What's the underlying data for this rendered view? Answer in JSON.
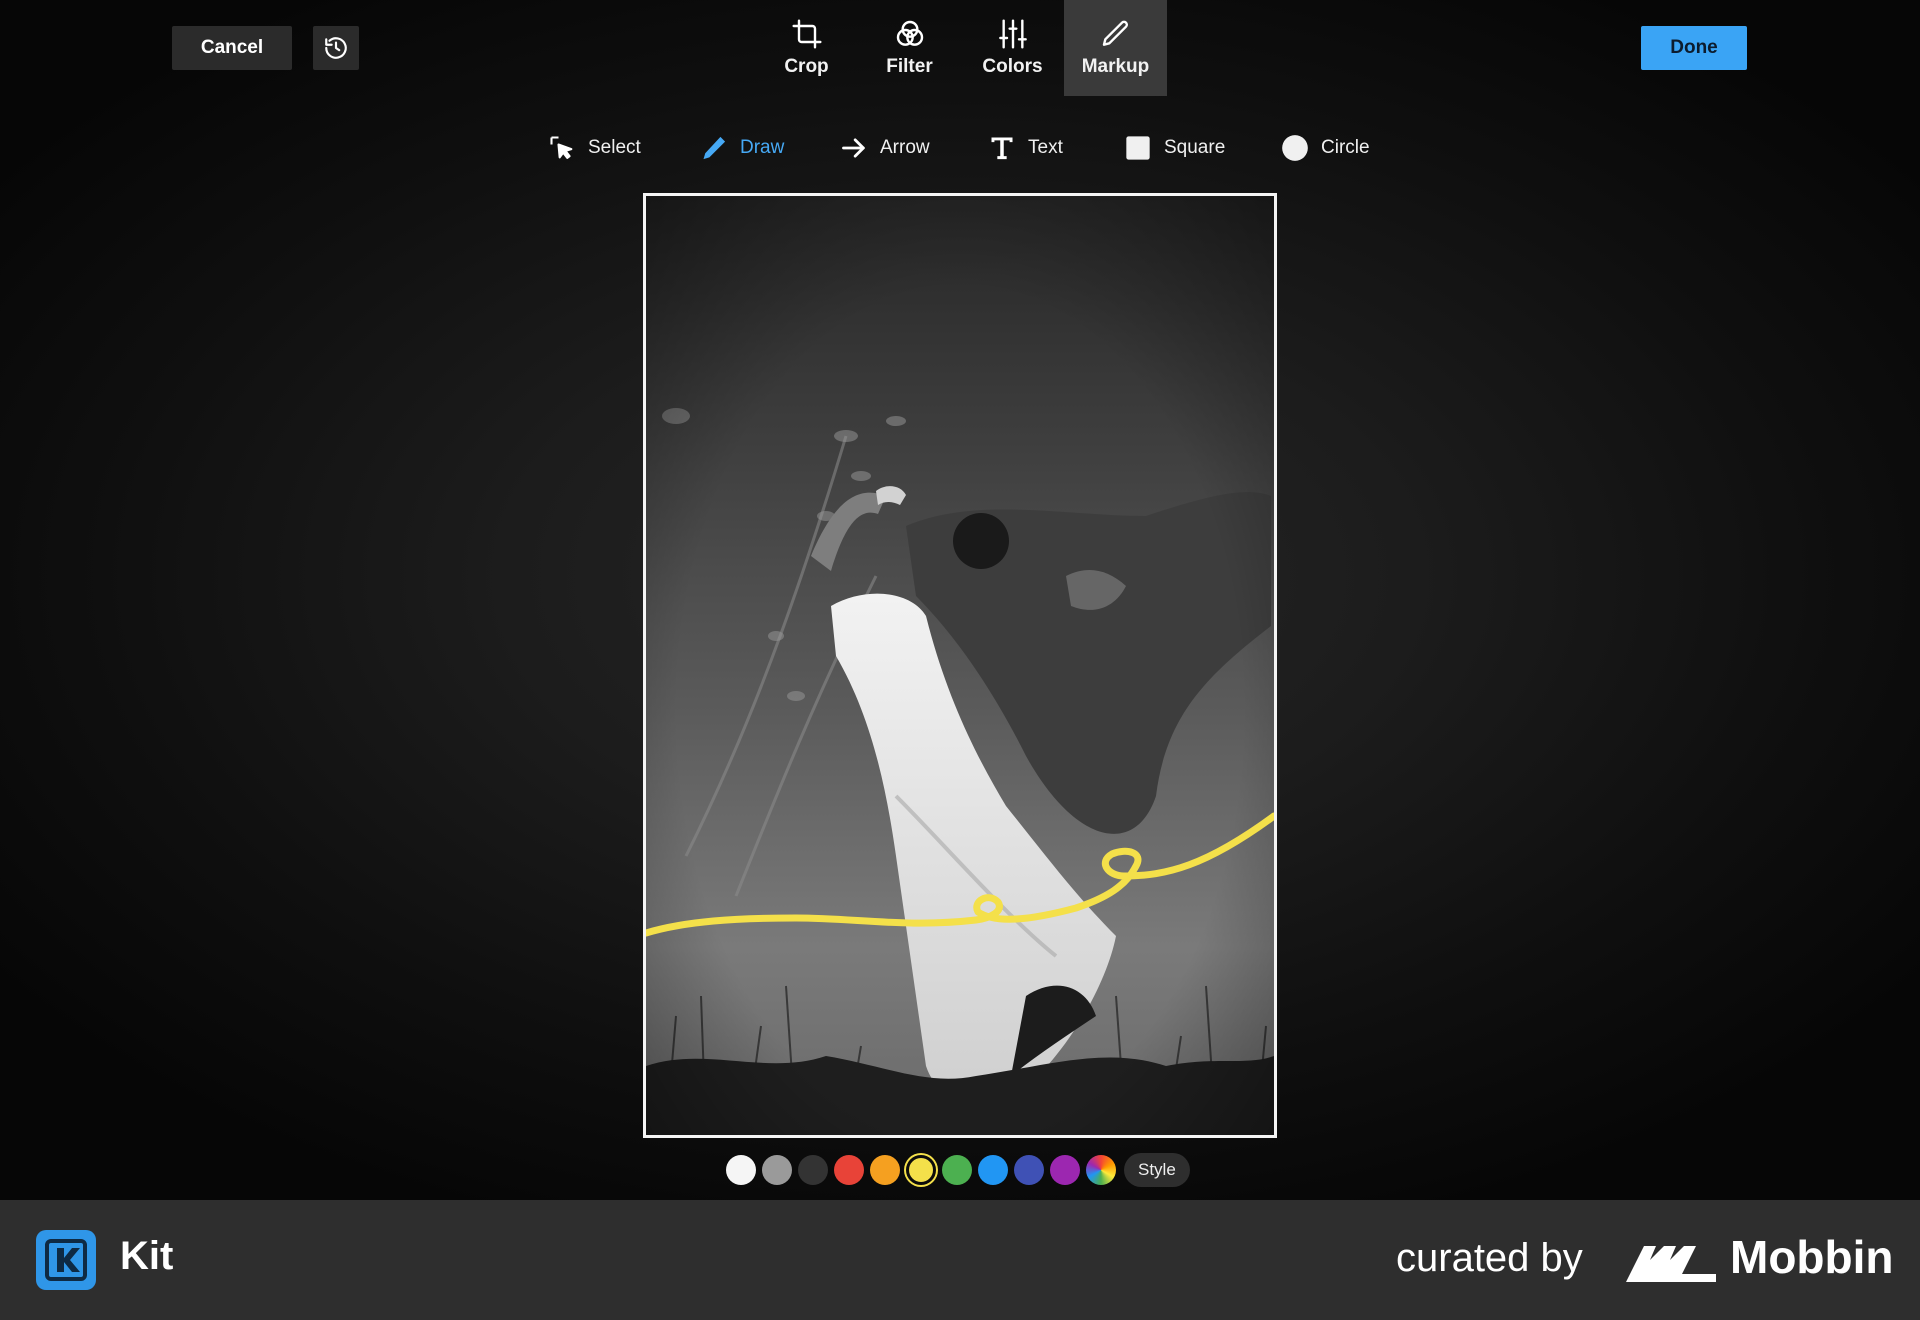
{
  "toolbar": {
    "cancel_label": "Cancel",
    "done_label": "Done",
    "history_icon": "history-icon"
  },
  "tabs": [
    {
      "label": "Crop",
      "icon": "crop-icon"
    },
    {
      "label": "Filter",
      "icon": "filter-icon"
    },
    {
      "label": "Colors",
      "icon": "sliders-icon"
    },
    {
      "label": "Markup",
      "icon": "pencil-icon",
      "active": true
    }
  ],
  "markup_tools": [
    {
      "label": "Select",
      "icon": "select-icon"
    },
    {
      "label": "Draw",
      "icon": "pen-icon",
      "active": true
    },
    {
      "label": "Arrow",
      "icon": "arrow-right-icon"
    },
    {
      "label": "Text",
      "icon": "text-icon"
    },
    {
      "label": "Square",
      "icon": "square-icon"
    },
    {
      "label": "Circle",
      "icon": "circle-icon"
    }
  ],
  "palette": {
    "colors": [
      "#f5f5f5",
      "#9a9a9a",
      "#333333",
      "#e84338",
      "#f5a020",
      "#f4e04a",
      "#4cb050",
      "#2196f3",
      "#3f51b5",
      "#9c27b0"
    ],
    "selected": "#f4e04a",
    "custom_color_icon": "color-wheel-icon",
    "style_label": "Style"
  },
  "accent_color": "#3aa4f5",
  "drawing_color": "#f4e04a",
  "footer": {
    "kit_name": "Kit",
    "curated_label": "curated by",
    "mobbin_name": "Mobbin"
  }
}
